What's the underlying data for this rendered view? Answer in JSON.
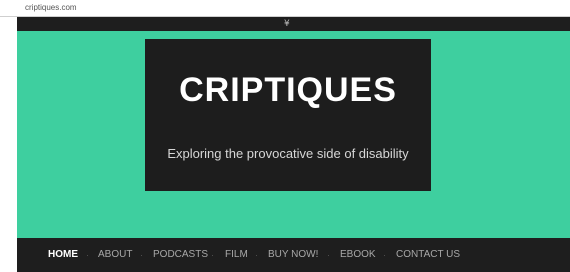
{
  "browser": {
    "url": "criptiques.com"
  },
  "top_strip": {
    "toggle_icon": "double-chevron-down-icon",
    "toggle_glyph": "¥"
  },
  "colors": {
    "hero_bg": "#3ecf9f",
    "dark_bg": "#1d1d1d",
    "nav_active": "#ffffff",
    "nav_inactive": "#a8a8a8"
  },
  "header": {
    "title": "CRIPTIQUES",
    "tagline": "Exploring the provocative side of disability"
  },
  "nav": {
    "items": [
      {
        "label": "HOME",
        "active": true
      },
      {
        "label": "ABOUT",
        "active": false
      },
      {
        "label": "PODCASTS",
        "active": false
      },
      {
        "label": "FILM",
        "active": false
      },
      {
        "label": "BUY NOW!",
        "active": false
      },
      {
        "label": "EBOOK",
        "active": false
      },
      {
        "label": "CONTACT US",
        "active": false
      }
    ]
  }
}
